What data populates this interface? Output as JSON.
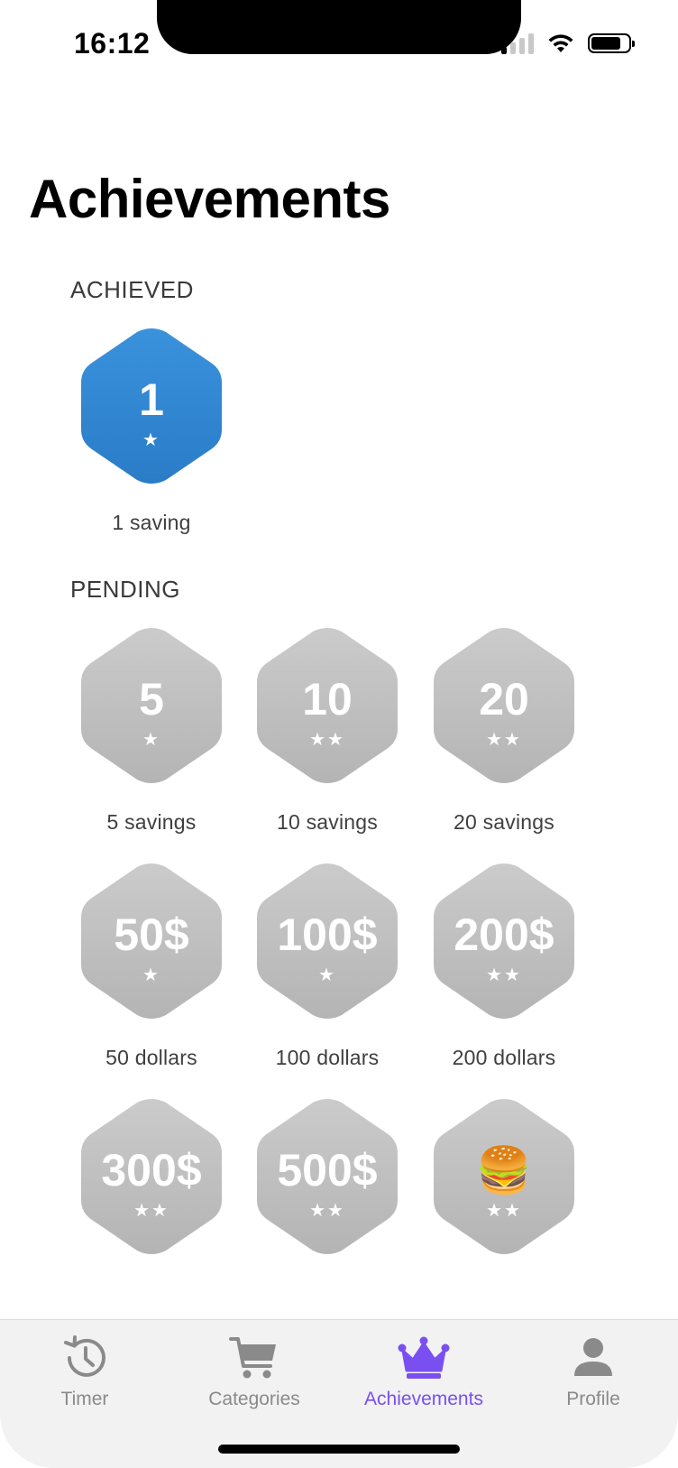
{
  "status_bar": {
    "time": "16:12"
  },
  "page_title": "Achievements",
  "sections": {
    "achieved": "ACHIEVED",
    "pending": "PENDING"
  },
  "achieved": [
    {
      "value": "1",
      "stars": "★",
      "label": "1 saving",
      "color": "#2f86d1"
    }
  ],
  "pending": [
    {
      "value": "5",
      "stars": "★",
      "label": "5 savings"
    },
    {
      "value": "10",
      "stars": "★★",
      "label": "10 savings"
    },
    {
      "value": "20",
      "stars": "★★",
      "label": "20 savings"
    },
    {
      "value": "50$",
      "stars": "★",
      "label": "50 dollars"
    },
    {
      "value": "100$",
      "stars": "★",
      "label": "100 dollars"
    },
    {
      "value": "200$",
      "stars": "★★",
      "label": "200 dollars"
    },
    {
      "value": "300$",
      "stars": "★★",
      "label": ""
    },
    {
      "value": "500$",
      "stars": "★★",
      "label": ""
    },
    {
      "value": "🍔",
      "stars": "★★",
      "label": ""
    }
  ],
  "colors": {
    "achieved": "#2f86d1",
    "pending": "#c2c2c2",
    "accent": "#7a4ff0"
  },
  "tab_bar": {
    "tabs": [
      {
        "label": "Timer",
        "icon": "history-icon"
      },
      {
        "label": "Categories",
        "icon": "cart-icon"
      },
      {
        "label": "Achievements",
        "icon": "crown-icon",
        "active": true
      },
      {
        "label": "Profile",
        "icon": "person-icon"
      }
    ]
  }
}
